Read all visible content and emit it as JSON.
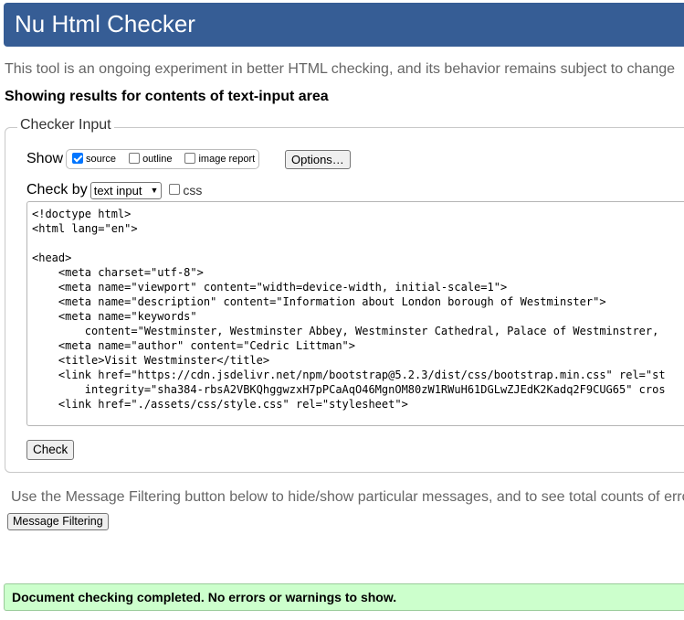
{
  "header": {
    "title": "Nu Html Checker"
  },
  "intro_text": "This tool is an ongoing experiment in better HTML checking, and its behavior remains subject to change",
  "showing_text": "Showing results for contents of text-input area",
  "checker_input": {
    "legend": "Checker Input",
    "show_label": "Show",
    "show_options": [
      {
        "label": "source",
        "checked": true
      },
      {
        "label": "outline",
        "checked": false
      },
      {
        "label": "image report",
        "checked": false
      }
    ],
    "options_button": "Options…",
    "check_by_label": "Check by",
    "check_by_value": "text input",
    "css_label": "css",
    "css_checked": false,
    "code_lines": [
      "<!doctype html>",
      "<html lang=\"en\">",
      "",
      "<head>",
      "    <meta charset=\"utf-8\">",
      "    <meta name=\"viewport\" content=\"width=device-width, initial-scale=1\">",
      "    <meta name=\"description\" content=\"Information about London borough of Westminster\">",
      "    <meta name=\"keywords\"",
      "        content=\"Westminster, Westminster Abbey, Westminster Cathedral, Palace of Westminstrer, ",
      "    <meta name=\"author\" content=\"Cedric Littman\">",
      "    <title>Visit Westminster</title>",
      "    <link href=\"https://cdn.jsdelivr.net/npm/bootstrap@5.2.3/dist/css/bootstrap.min.css\" rel=\"st",
      "        integrity=\"sha384-rbsA2VBKQhggwzxH7pPCaAqO46MgnOM80zW1RWuH61DGLwZJEdK2Kadq2F9CUG65\" cros",
      "    <link href=\"./assets/css/style.css\" rel=\"stylesheet\">"
    ],
    "check_button": "Check"
  },
  "filter_note": "Use the Message Filtering button below to hide/show particular messages, and to see total counts of erro",
  "filter_button": "Message Filtering",
  "status_message": "Document checking completed. No errors or warnings to show.",
  "colors": {
    "header_bg": "#365d95",
    "success_bg": "#ccffcc",
    "checkbox_accent": "#0075ff"
  }
}
